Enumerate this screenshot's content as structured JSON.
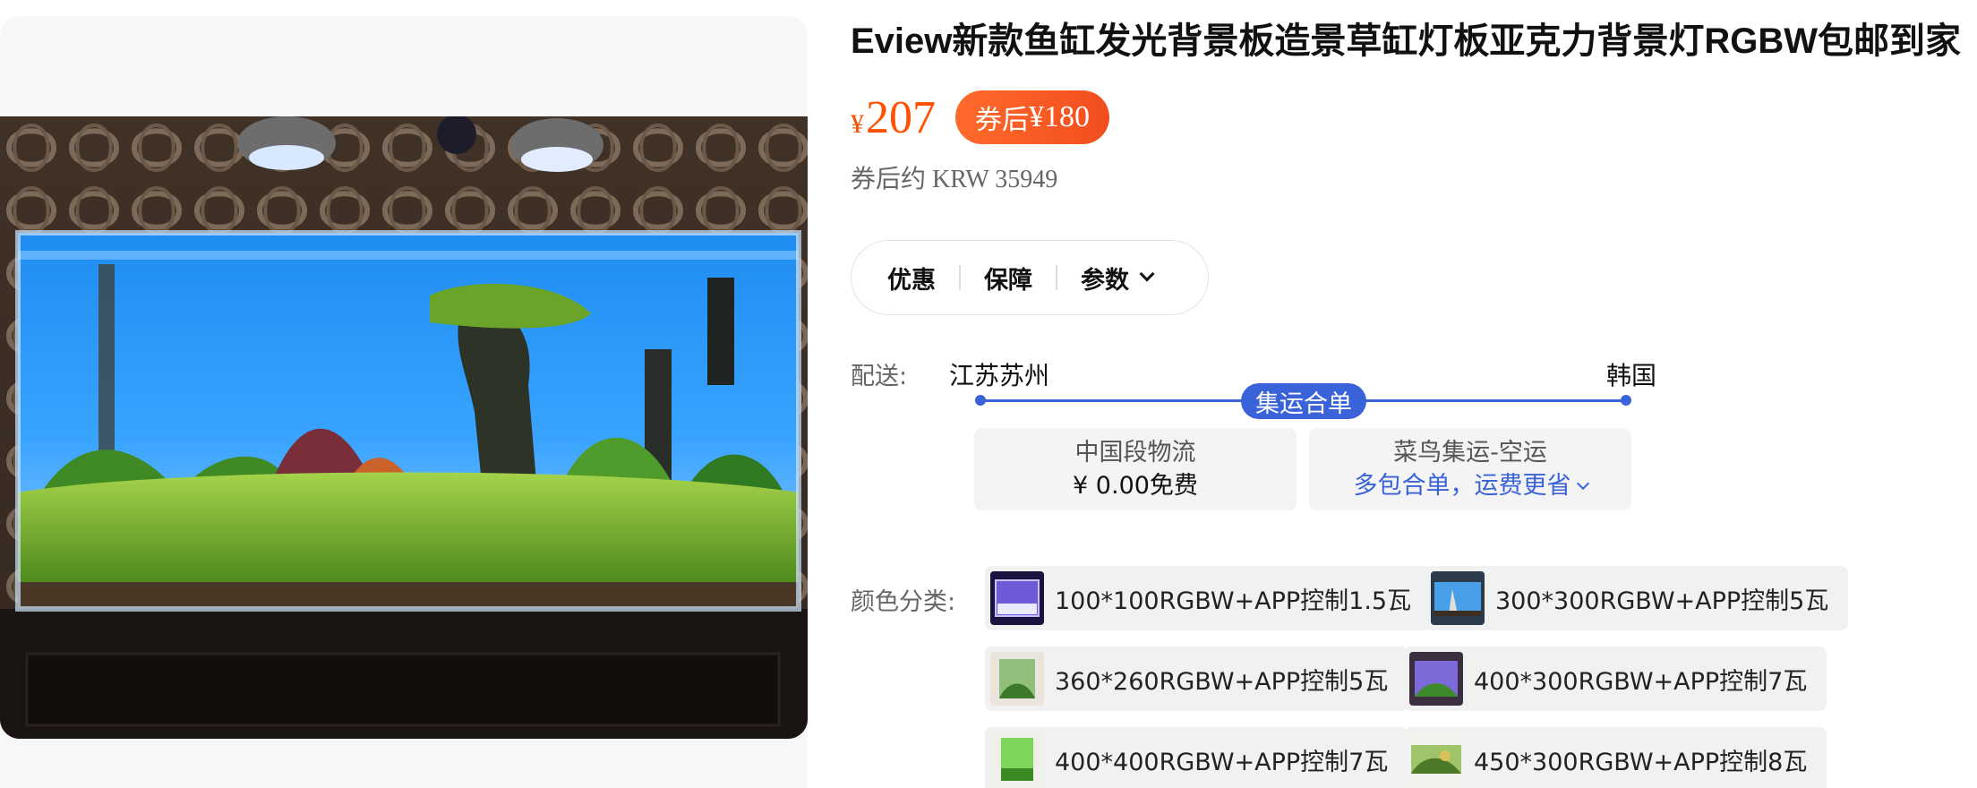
{
  "product": {
    "title": "Eview新款鱼缸发光背景板造景草缸灯板亚克力背景灯RGBW包邮到家"
  },
  "price": {
    "currency": "¥",
    "value": "207",
    "coupon_prefix": "券后",
    "coupon_currency": "¥",
    "coupon_value": "180",
    "krw_prefix": "券后约",
    "krw_value": "KRW 35949"
  },
  "tabs": [
    {
      "label": "优惠"
    },
    {
      "label": "保障"
    },
    {
      "label": "参数"
    }
  ],
  "shipping": {
    "label": "配送:",
    "from": "江苏苏州",
    "to": "韩国",
    "badge": "集运合单",
    "segments": [
      {
        "title": "中国段物流",
        "value": "¥ 0.00免费"
      },
      {
        "title": "菜鸟集运-空运",
        "value": "多包合单，运费更省"
      }
    ]
  },
  "variants": {
    "label": "颜色分类:",
    "items": [
      {
        "label": "100*100RGBW+APP控制1.5瓦",
        "thumb": "purple-tank"
      },
      {
        "label": "300*300RGBW+APP控制5瓦",
        "thumb": "blue-tank"
      },
      {
        "label": "360*260RGBW+APP控制5瓦",
        "thumb": "green-tank"
      },
      {
        "label": "400*300RGBW+APP控制7瓦",
        "thumb": "violet-tank"
      },
      {
        "label": "400*400RGBW+APP控制7瓦",
        "thumb": "bright-green-tank"
      },
      {
        "label": "450*300RGBW+APP控制8瓦",
        "thumb": "landscape-tank"
      }
    ]
  },
  "colors": {
    "accent": "#ff5000",
    "link_blue": "#3a63d9"
  }
}
